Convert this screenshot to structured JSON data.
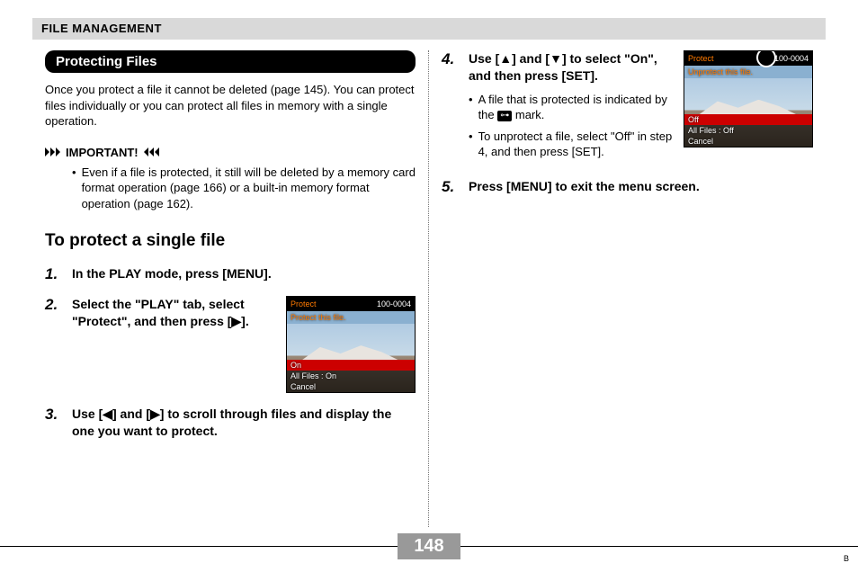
{
  "header": "FILE MANAGEMENT",
  "left": {
    "section_title": "Protecting Files",
    "intro": "Once you protect a file it cannot be deleted (page 145). You can protect files individually or you can protect all files in memory with a single operation.",
    "important_label": "IMPORTANT!",
    "important_text": "Even if a file is protected, it still will be deleted by a memory card format operation (page 166) or a built-in memory format operation (page 162).",
    "subhead": "To protect a single file",
    "step1": {
      "num": "1.",
      "text": "In the PLAY mode, press [MENU]."
    },
    "step2": {
      "num": "2.",
      "text": "Select the \"PLAY\" tab, select \"Protect\", and then press [▶]."
    },
    "step3": {
      "num": "3.",
      "text": "Use [◀] and [▶] to scroll through files and display the one you want to protect."
    },
    "thumb1": {
      "title": "Protect",
      "counter": "100-0004",
      "line": "Protect this file.",
      "menu_hl": "On",
      "menu_2": "All Files : On",
      "menu_3": "Cancel"
    }
  },
  "right": {
    "step4": {
      "num": "4.",
      "text": "Use [▲] and [▼] to select \"On\", and then press [SET].",
      "sub1_a": "A file that is protected is indicated by the ",
      "sub1_b": " mark.",
      "sub2": "To unprotect a file, select \"Off\" in step 4, and then press [SET]."
    },
    "step5": {
      "num": "5.",
      "text": "Press [MENU] to exit the menu screen."
    },
    "thumb2": {
      "title": "Protect",
      "counter": "100-0004",
      "line": "Unprotect this file.",
      "menu_hl": "Off",
      "menu_2": "All Files : Off",
      "menu_3": "Cancel"
    },
    "key_icon": "⊶"
  },
  "page_number": "148",
  "corner": "B"
}
